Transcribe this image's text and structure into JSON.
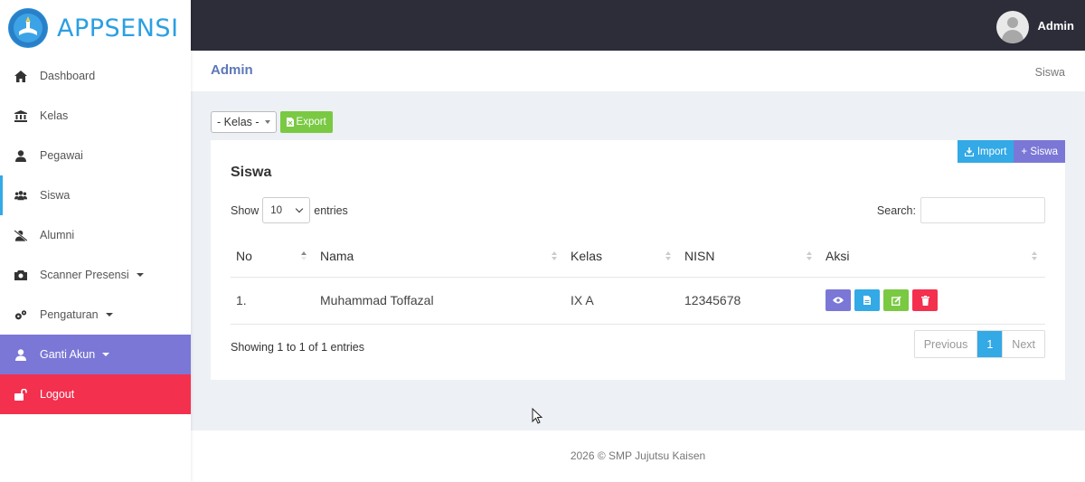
{
  "brand": {
    "name": "APPSENSI"
  },
  "sidebar": {
    "items": [
      {
        "label": "Dashboard"
      },
      {
        "label": "Kelas"
      },
      {
        "label": "Pegawai"
      },
      {
        "label": "Siswa"
      },
      {
        "label": "Alumni"
      },
      {
        "label": "Scanner Presensi"
      },
      {
        "label": "Pengaturan"
      },
      {
        "label": "Ganti Akun"
      },
      {
        "label": "Logout"
      }
    ],
    "active_color": "#33a9e6",
    "accent_purple": "#7b77d6",
    "accent_red": "#f4304f"
  },
  "topbar": {
    "user": "Admin"
  },
  "breadcrumb": {
    "title": "Admin",
    "current": "Siswa"
  },
  "filter": {
    "kelas_selected": "- Kelas -",
    "export_label": "Export"
  },
  "card": {
    "title": "Siswa",
    "import_label": "Import",
    "add_label": "+ Siswa",
    "show_label": "Show",
    "entries_value": "10",
    "entries_label": "entries",
    "search_label": "Search:"
  },
  "table": {
    "headers": [
      "No",
      "Nama",
      "Kelas",
      "NISN",
      "Aksi"
    ],
    "rows": [
      {
        "no": "1.",
        "nama": "Muhammad Toffazal",
        "kelas": "IX A",
        "nisn": "12345678"
      }
    ]
  },
  "pagination": {
    "info": "Showing 1 to 1 of 1 entries",
    "previous": "Previous",
    "current": "1",
    "next": "Next"
  },
  "footer": {
    "text": "2026 © SMP Jujutsu Kaisen"
  }
}
